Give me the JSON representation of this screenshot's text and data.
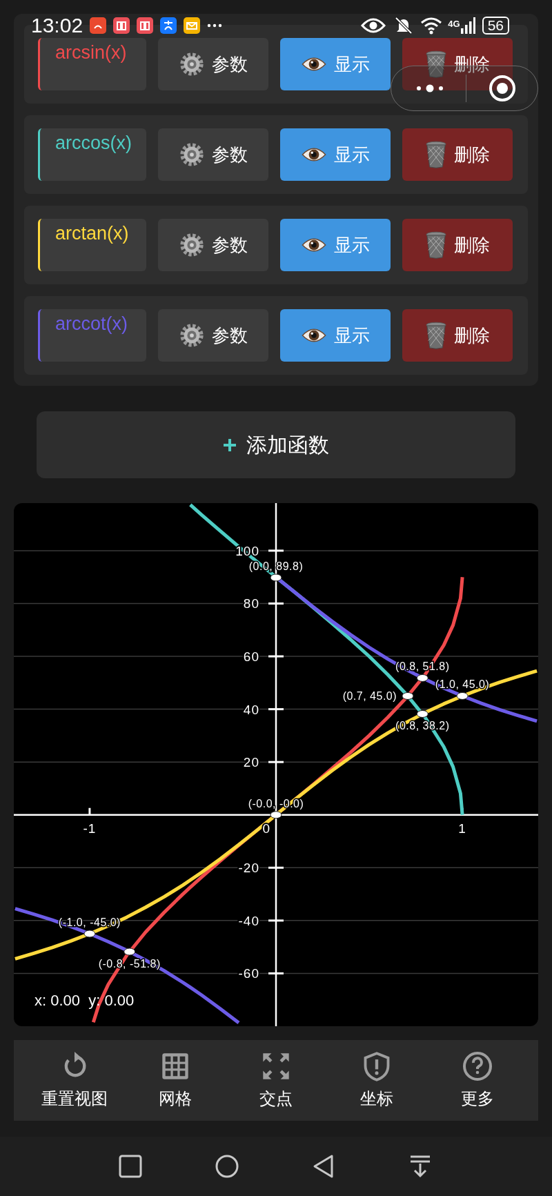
{
  "status_bar": {
    "time": "13:02",
    "network": "4G",
    "battery": "56"
  },
  "functions": [
    {
      "name": "arcsin(x)",
      "color": "#f04a4c",
      "visible": true,
      "params_label": "参数",
      "show_label": "显示",
      "delete_label": "删除"
    },
    {
      "name": "arccos(x)",
      "color": "#4ecdc4",
      "visible": true,
      "params_label": "参数",
      "show_label": "显示",
      "delete_label": "删除"
    },
    {
      "name": "arctan(x)",
      "color": "#ffd93d",
      "visible": true,
      "params_label": "参数",
      "show_label": "显示",
      "delete_label": "删除"
    },
    {
      "name": "arccot(x)",
      "color": "#6c5ce7",
      "visible": true,
      "params_label": "参数",
      "show_label": "显示",
      "delete_label": "删除"
    }
  ],
  "add_button": "添加函数",
  "graph": {
    "chart_data": {
      "type": "line",
      "x": [
        -1.4,
        -1.3,
        -1.2,
        -1.1,
        -1,
        -0.98,
        -0.95,
        -0.9,
        -0.8,
        -0.7,
        -0.6,
        -0.5,
        -0.46,
        -0.4,
        -0.3,
        -0.2,
        -0.1,
        -0.01,
        0.01,
        0.1,
        0.2,
        0.3,
        0.4,
        0.5,
        0.6,
        0.7,
        0.8,
        0.9,
        0.95,
        0.99,
        1,
        1.1,
        1.2,
        1.3,
        1.4
      ],
      "series": [
        {
          "color": "#f04a4c",
          "values": [
            null,
            null,
            null,
            null,
            null,
            -78.5,
            -71.8,
            -64.2,
            -53.1,
            -44.4,
            -36.9,
            -30,
            -27.4,
            -23.6,
            -17.5,
            -11.5,
            -5.7,
            -0.6,
            0.6,
            5.7,
            11.5,
            17.5,
            23.6,
            30,
            36.9,
            44.4,
            53.1,
            64.2,
            71.8,
            81.9,
            90,
            null,
            null,
            null,
            null
          ]
        },
        {
          "color": "#4ecdc4",
          "values": [
            null,
            null,
            null,
            null,
            null,
            null,
            null,
            null,
            null,
            null,
            null,
            null,
            117.4,
            113.6,
            107.5,
            101.5,
            95.7,
            90.6,
            89.4,
            84.3,
            78.5,
            72.5,
            66.4,
            60,
            53.1,
            45.6,
            36.9,
            25.8,
            18.2,
            8.1,
            0,
            null,
            null,
            null,
            null
          ]
        },
        {
          "color": "#ffd93d",
          "values": [
            -54.5,
            -52.4,
            -50.2,
            -47.7,
            -45,
            -44.4,
            -43.5,
            -42,
            -38.7,
            -35,
            -31,
            -26.6,
            -24.7,
            -21.8,
            -16.7,
            -11.3,
            -5.7,
            -0.6,
            0.6,
            5.7,
            11.3,
            16.7,
            21.8,
            26.6,
            31,
            35,
            38.7,
            42,
            43.5,
            44.7,
            45,
            47.7,
            50.2,
            52.4,
            54.5
          ]
        },
        {
          "color": "#6c5ce7",
          "values": [
            -35.5,
            -37.6,
            -39.8,
            -42.3,
            -45,
            -45.6,
            -46.5,
            -48,
            -51.3,
            -55,
            -59,
            -63.4,
            -65.3,
            -68.2,
            -73.3,
            -78.7,
            null,
            null,
            89.4,
            84.3,
            78.7,
            73.3,
            68.2,
            63.4,
            59,
            55,
            51.3,
            48,
            46.5,
            45.3,
            45,
            42.3,
            39.8,
            37.6,
            35.5
          ]
        }
      ],
      "grid": true,
      "xlim": [
        -1.407,
        1.407
      ],
      "ylim": [
        -80,
        118
      ],
      "xticks": [
        {
          "value": -1,
          "label": "-1"
        },
        {
          "value": 1,
          "label": "1"
        }
      ],
      "yticks": [
        {
          "value": -60,
          "label": "-60"
        },
        {
          "value": -40,
          "label": "-40"
        },
        {
          "value": -20,
          "label": "-20"
        },
        {
          "value": 20,
          "label": "20"
        },
        {
          "value": 40,
          "label": "40"
        },
        {
          "value": 60,
          "label": "60"
        },
        {
          "value": 80,
          "label": "80"
        },
        {
          "value": 100,
          "label": "100"
        }
      ],
      "annotations": [
        {
          "x": 0,
          "y": 89.8,
          "text": "(0.0, 89.8)"
        },
        {
          "x": 0.786,
          "y": 51.8,
          "text": "(0.8, 51.8)"
        },
        {
          "x": 0.707,
          "y": 45,
          "text": "(0.7, 45.0)"
        },
        {
          "x": 1,
          "y": 45,
          "text": "(1.0, 45.0)"
        },
        {
          "x": 0.786,
          "y": 38.2,
          "text": "(0.8, 38.2)"
        },
        {
          "x": 0,
          "y": 0,
          "text": "(-0.0, -0.0)"
        },
        {
          "x": -1,
          "y": -45,
          "text": "(-1.0, -45.0)"
        },
        {
          "x": -0.786,
          "y": -51.8,
          "text": "(-0.8, -51.8)"
        }
      ]
    },
    "origin_label": "0",
    "cursor": "x: 0.00  y: 0.00"
  },
  "toolbar": [
    {
      "kind": "reset",
      "label": "重置视图"
    },
    {
      "kind": "grid",
      "label": "网格"
    },
    {
      "kind": "intersections",
      "label": "交点"
    },
    {
      "kind": "coordinates",
      "label": "坐标"
    },
    {
      "kind": "more",
      "label": "更多"
    }
  ]
}
